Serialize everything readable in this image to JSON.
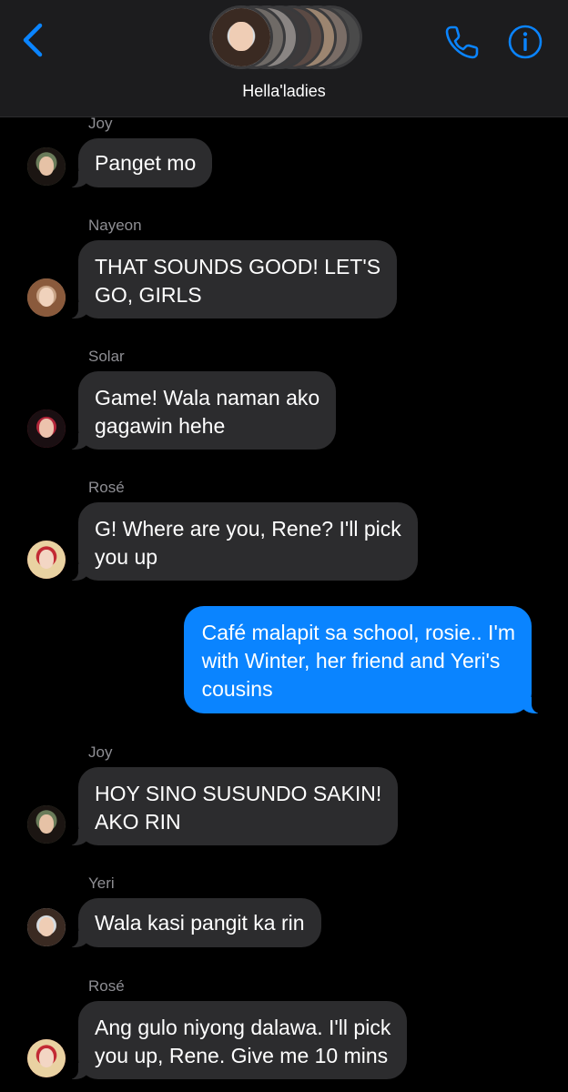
{
  "header": {
    "group_name": "Hella'ladies",
    "accent_color": "#0a84ff",
    "back_icon": "chevron-left-icon",
    "call_icon": "phone-icon",
    "info_icon": "info-icon"
  },
  "messages": [
    {
      "sender": "Joy",
      "text": "Panget mo",
      "direction": "incoming"
    },
    {
      "sender": "Nayeon",
      "text": "THAT SOUNDS GOOD! LET'S\nGO, GIRLS",
      "direction": "incoming"
    },
    {
      "sender": "Solar",
      "text": "Game! Wala naman ako\ngagawin hehe",
      "direction": "incoming"
    },
    {
      "sender": "Rosé",
      "text": "G! Where are you, Rene? I'll pick\nyou up",
      "direction": "incoming"
    },
    {
      "sender": "",
      "text": "Café malapit sa school, rosie.. I'm\nwith Winter, her friend and Yeri's\ncousins",
      "direction": "outgoing"
    },
    {
      "sender": "Joy",
      "text": "HOY SINO SUSUNDO SAKIN!\nAKO RIN",
      "direction": "incoming"
    },
    {
      "sender": "Yeri",
      "text": "Wala kasi pangit ka rin",
      "direction": "incoming"
    },
    {
      "sender": "Rosé",
      "text": "Ang gulo niyong dalawa. I'll pick\nyou up, Rene. Give me 10 mins",
      "direction": "incoming"
    }
  ]
}
